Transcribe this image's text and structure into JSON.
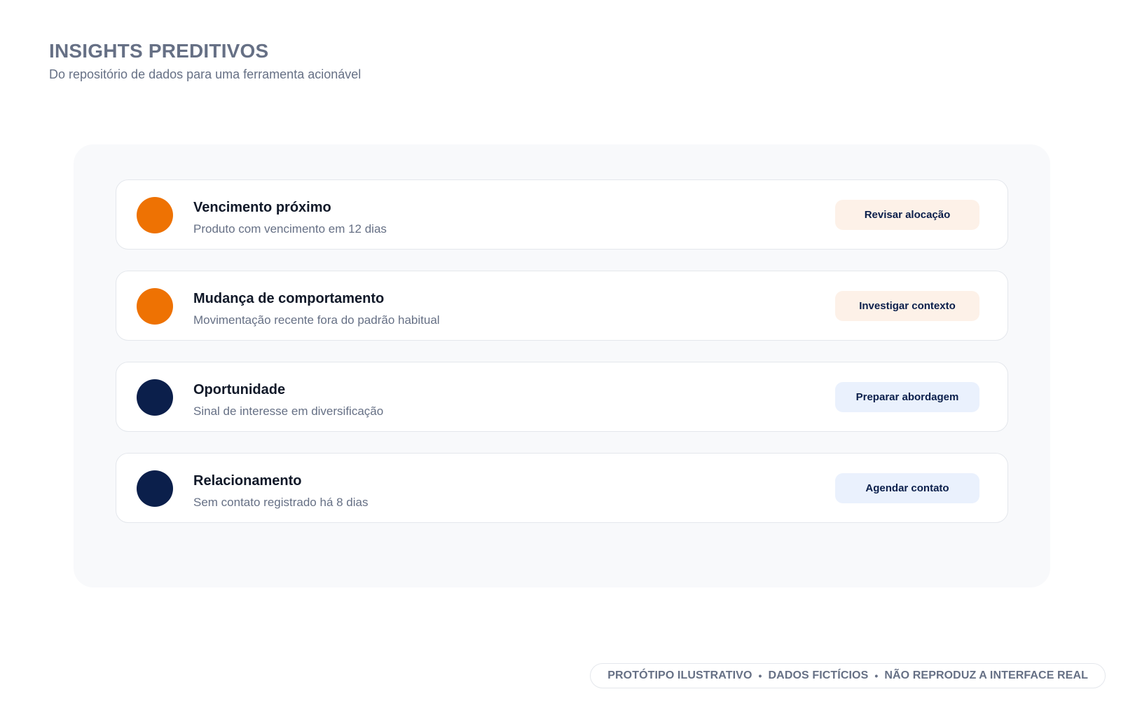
{
  "header": {
    "title": "INSIGHTS PREDITIVOS",
    "subtitle": "Do repositório de dados para uma ferramenta acionável"
  },
  "insights": [
    {
      "title": "Vencimento próximo",
      "description": "Produto com vencimento em 12 dias",
      "action": "Revisar alocação",
      "dot_color": "#ee7203",
      "button_bg": "#fdf1e8"
    },
    {
      "title": "Mudança de comportamento",
      "description": "Movimentação recente fora do padrão habitual",
      "action": "Investigar contexto",
      "dot_color": "#ee7203",
      "button_bg": "#fdf1e8"
    },
    {
      "title": "Oportunidade",
      "description": "Sinal de interesse em diversificação",
      "action": "Preparar abordagem",
      "dot_color": "#0b1f4b",
      "button_bg": "#eaf1fd"
    },
    {
      "title": "Relacionamento",
      "description": "Sem contato registrado há 8 dias",
      "action": "Agendar contato",
      "dot_color": "#0b1f4b",
      "button_bg": "#eaf1fd"
    }
  ],
  "footer": {
    "items": [
      "PROTÓTIPO ILUSTRATIVO",
      "DADOS FICTÍCIOS",
      "NÃO REPRODUZ A INTERFACE REAL"
    ],
    "separator": "•"
  }
}
